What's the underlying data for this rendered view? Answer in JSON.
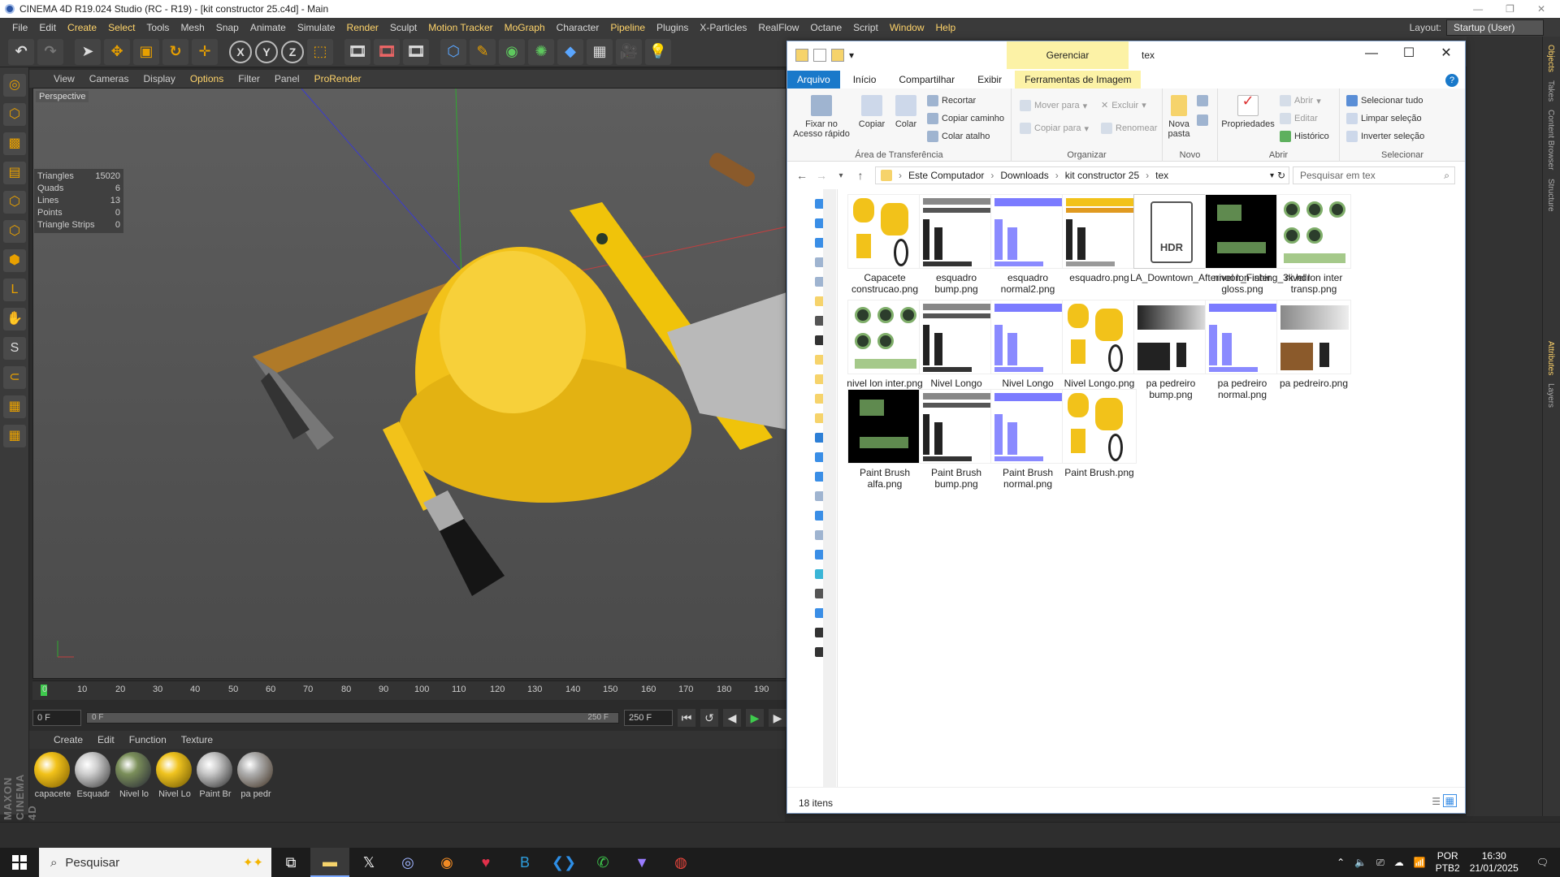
{
  "c4d": {
    "title": "CINEMA 4D R19.024 Studio (RC - R19) - [kit constructor 25.c4d] - Main",
    "menus": [
      "File",
      "Edit",
      "Create",
      "Select",
      "Tools",
      "Mesh",
      "Snap",
      "Animate",
      "Simulate",
      "Render",
      "Sculpt",
      "Motion Tracker",
      "MoGraph",
      "Character",
      "Pipeline",
      "Plugins",
      "X-Particles",
      "RealFlow",
      "Octane",
      "Script",
      "Window",
      "Help"
    ],
    "layout_label": "Layout:",
    "layout_value": "Startup (User)",
    "viewport_menu": [
      "View",
      "Cameras",
      "Display",
      "Options",
      "Filter",
      "Panel",
      "ProRender"
    ],
    "viewport_label": "Perspective",
    "stats": [
      {
        "k": "Triangles",
        "v": "15020"
      },
      {
        "k": "Quads",
        "v": "6"
      },
      {
        "k": "Lines",
        "v": "13"
      },
      {
        "k": "Points",
        "v": "0"
      },
      {
        "k": "Triangle Strips",
        "v": "0"
      }
    ],
    "timeline_ticks": [
      "0",
      "10",
      "20",
      "30",
      "40",
      "50",
      "60",
      "70",
      "80",
      "90",
      "100",
      "110",
      "120",
      "130",
      "140",
      "150",
      "160",
      "170",
      "180",
      "190"
    ],
    "frame_start": "0 F",
    "range_start": "0 F",
    "range_end": "250 F",
    "frame_end": "250 F",
    "material_menu": [
      "Create",
      "Edit",
      "Function",
      "Texture"
    ],
    "materials": [
      {
        "name": "capacete",
        "color": "#f2c21a"
      },
      {
        "name": "Esquadr",
        "color": "#cfcfcf"
      },
      {
        "name": "Nivel lo",
        "color": "#7b8f5a"
      },
      {
        "name": "Nivel Lo",
        "color": "#f0c420"
      },
      {
        "name": "Paint Br",
        "color": "#c8c8c8"
      },
      {
        "name": "pa pedr",
        "color": "#b0b0b0"
      }
    ],
    "maxon_logo": "MAXON CINEMA 4D",
    "right_tabs": [
      "Objects",
      "Takes",
      "Content Browser",
      "Structure",
      "Attributes",
      "Layers"
    ]
  },
  "explorer": {
    "manage_tab": "Gerenciar",
    "folder_name": "tex",
    "tabs": [
      "Arquivo",
      "Início",
      "Compartilhar",
      "Exibir",
      "Ferramentas de Imagem"
    ],
    "ribbon": {
      "pin": "Fixar no Acesso rápido",
      "copy": "Copiar",
      "paste": "Colar",
      "cut": "Recortar",
      "copy_path": "Copiar caminho",
      "paste_shortcut": "Colar atalho",
      "group_clipboard": "Área de Transferência",
      "move_to": "Mover para",
      "copy_to": "Copiar para",
      "delete": "Excluir",
      "rename": "Renomear",
      "group_organize": "Organizar",
      "new_folder": "Nova pasta",
      "group_new": "Novo",
      "properties": "Propriedades",
      "open": "Abrir",
      "edit": "Editar",
      "history": "Histórico",
      "group_open": "Abrir",
      "select_all": "Selecionar tudo",
      "clear_selection": "Limpar seleção",
      "invert_selection": "Inverter seleção",
      "group_select": "Selecionar"
    },
    "path": [
      "Este Computador",
      "Downloads",
      "kit constructor 25",
      "tex"
    ],
    "search_placeholder": "Pesquisar em tex",
    "files": [
      {
        "name": "Capacete construcao.png",
        "kind": "yellow"
      },
      {
        "name": "esquadro bump.png",
        "kind": "gray"
      },
      {
        "name": "esquadro normal2.png",
        "kind": "blue"
      },
      {
        "name": "esquadro.png",
        "kind": "yellowgray"
      },
      {
        "name": "LA_Downtown_Afternoon_Fishing_3k.hdr",
        "kind": "hdr"
      },
      {
        "name": "nivel lon inter gloss.png",
        "kind": "black"
      },
      {
        "name": "nivel lon inter transp.png",
        "kind": "greencircles"
      },
      {
        "name": "nivel lon inter.png",
        "kind": "greencircles2"
      },
      {
        "name": "Nivel Longo bump.png",
        "kind": "gray"
      },
      {
        "name": "Nivel Longo normal.png",
        "kind": "blue"
      },
      {
        "name": "Nivel Longo.png",
        "kind": "yellow"
      },
      {
        "name": "pa pedreiro bump.png",
        "kind": "dark"
      },
      {
        "name": "pa pedreiro normal.png",
        "kind": "blue"
      },
      {
        "name": "pa pedreiro.png",
        "kind": "brown"
      },
      {
        "name": "Paint Brush alfa.png",
        "kind": "black"
      },
      {
        "name": "Paint Brush bump.png",
        "kind": "gray"
      },
      {
        "name": "Paint Brush normal.png",
        "kind": "blue"
      },
      {
        "name": "Paint Brush.png",
        "kind": "yellow"
      }
    ],
    "hdr_label": "HDR",
    "status": "18 itens"
  },
  "taskbar": {
    "search": "Pesquisar",
    "lang": "POR",
    "layout": "PTB2",
    "time": "16:30",
    "date": "21/01/2025"
  }
}
